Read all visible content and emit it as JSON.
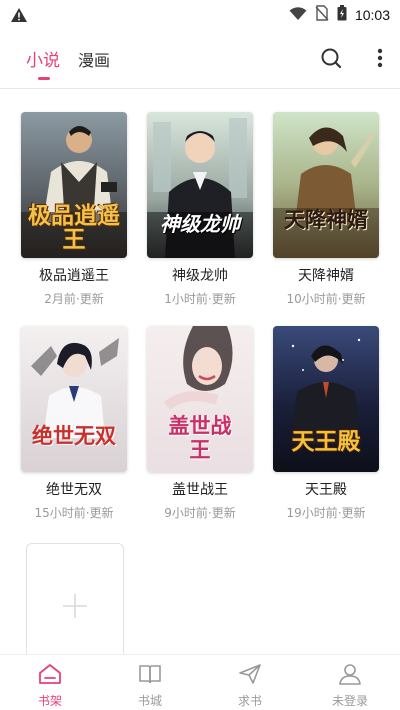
{
  "status_bar": {
    "time": "10:03",
    "icons": [
      "warning-icon",
      "wifi-icon",
      "no-sim-icon",
      "battery-icon"
    ]
  },
  "header": {
    "tabs": [
      {
        "label": "小说",
        "active": true
      },
      {
        "label": "漫画",
        "active": false
      }
    ],
    "accent_color": "#e8407a",
    "actions": [
      "search-icon",
      "more-vertical-icon"
    ]
  },
  "books": [
    {
      "title": "极品逍遥王",
      "update": "2月前·更新",
      "cover_text": "极品逍遥王"
    },
    {
      "title": "神级龙帅",
      "update": "1小时前·更新",
      "cover_text": "神级龙帅"
    },
    {
      "title": "天降神婿",
      "update": "10小时前·更新",
      "cover_text": "天降神婿"
    },
    {
      "title": "绝世无双",
      "update": "15小时前·更新",
      "cover_text": "绝世无双"
    },
    {
      "title": "盖世战王",
      "update": "9小时前·更新",
      "cover_text": "盖世战王"
    },
    {
      "title": "天王殿",
      "update": "19小时前·更新",
      "cover_text": "天王殿"
    }
  ],
  "add_book": {
    "icon": "plus-icon"
  },
  "bottom_nav": [
    {
      "label": "书架",
      "icon": "bookshelf-icon",
      "active": true
    },
    {
      "label": "书城",
      "icon": "book-icon",
      "active": false
    },
    {
      "label": "求书",
      "icon": "send-icon",
      "active": false
    },
    {
      "label": "未登录",
      "icon": "user-icon",
      "active": false
    }
  ]
}
